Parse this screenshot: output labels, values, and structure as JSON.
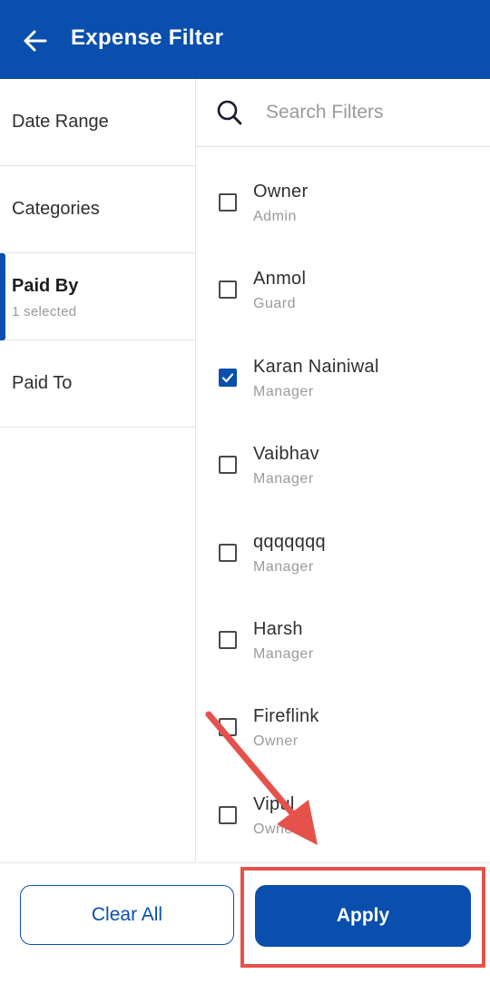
{
  "header": {
    "title": "Expense Filter",
    "back_icon": "arrow-left-icon"
  },
  "sidebar": {
    "items": [
      {
        "label": "Date Range",
        "sub": ""
      },
      {
        "label": "Categories",
        "sub": ""
      },
      {
        "label": "Paid By",
        "sub": "1 selected"
      },
      {
        "label": "Paid To",
        "sub": ""
      }
    ],
    "active_index": 2
  },
  "search": {
    "placeholder": "Search Filters",
    "value": ""
  },
  "options": [
    {
      "name": "Owner",
      "role": "Admin",
      "checked": false
    },
    {
      "name": "Anmol",
      "role": "Guard",
      "checked": false
    },
    {
      "name": "Karan Nainiwal",
      "role": "Manager",
      "checked": true
    },
    {
      "name": "Vaibhav",
      "role": "Manager",
      "checked": false
    },
    {
      "name": "qqqqqqq",
      "role": "Manager",
      "checked": false
    },
    {
      "name": "Harsh",
      "role": "Manager",
      "checked": false
    },
    {
      "name": "Fireflink",
      "role": "Owner",
      "checked": false
    },
    {
      "name": "Vipul",
      "role": "Owner",
      "checked": false
    }
  ],
  "footer": {
    "clear_label": "Clear All",
    "apply_label": "Apply"
  },
  "colors": {
    "primary": "#0a4fad",
    "annotation": "#e5524c"
  }
}
